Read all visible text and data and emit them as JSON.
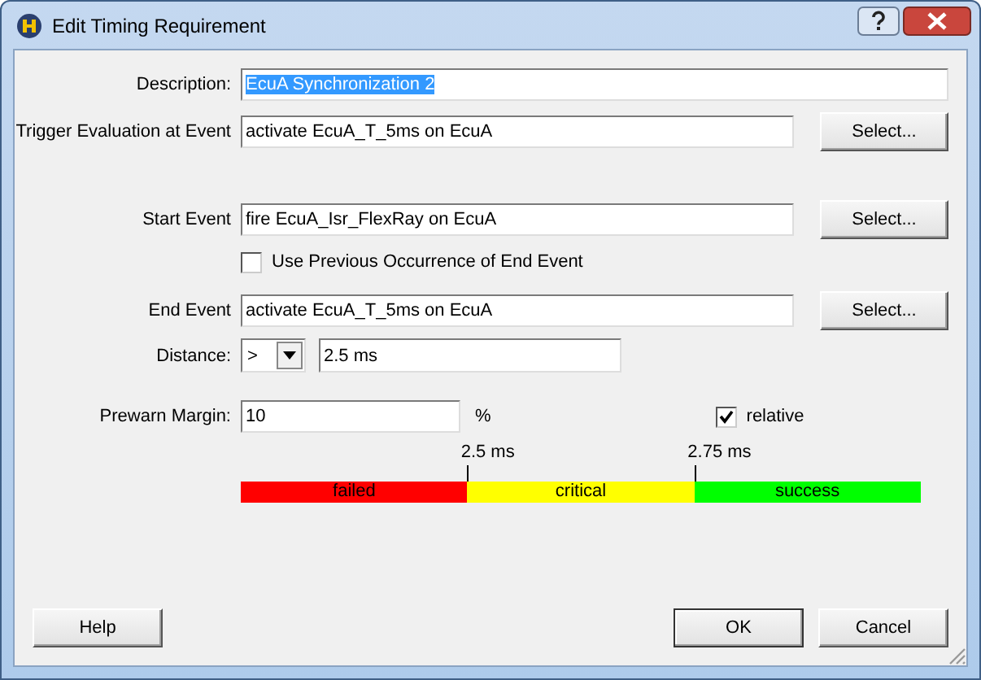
{
  "window": {
    "title": "Edit Timing Requirement"
  },
  "description": {
    "label": "Description:",
    "value": "EcuA Synchronization 2",
    "text_selected": true
  },
  "trigger_event": {
    "label": "Trigger Evaluation at Event",
    "value": "activate EcuA_T_5ms on EcuA",
    "button": "Select..."
  },
  "start_event": {
    "label": "Start Event",
    "value": "fire EcuA_Isr_FlexRay on EcuA",
    "button": "Select..."
  },
  "use_previous": {
    "label": "Use Previous Occurrence of End Event",
    "checked": false
  },
  "end_event": {
    "label": "End Event",
    "value": "activate EcuA_T_5ms on EcuA",
    "button": "Select..."
  },
  "distance": {
    "label": "Distance:",
    "operator": ">",
    "value": "2.5 ms"
  },
  "prewarn": {
    "label": "Prewarn Margin:",
    "value": "10",
    "unit": "%"
  },
  "relative": {
    "label": "relative",
    "checked": true
  },
  "scale": {
    "thresholds": [
      "2.5 ms",
      "2.75 ms"
    ],
    "segments": [
      {
        "label": "failed",
        "color": "#ff0000"
      },
      {
        "label": "critical",
        "color": "#ffff00"
      },
      {
        "label": "success",
        "color": "#00ff00"
      }
    ]
  },
  "buttons": [
    {
      "label": "Help",
      "default": false
    },
    {
      "label": "OK",
      "default": true
    },
    {
      "label": "Cancel",
      "default": false
    }
  ]
}
